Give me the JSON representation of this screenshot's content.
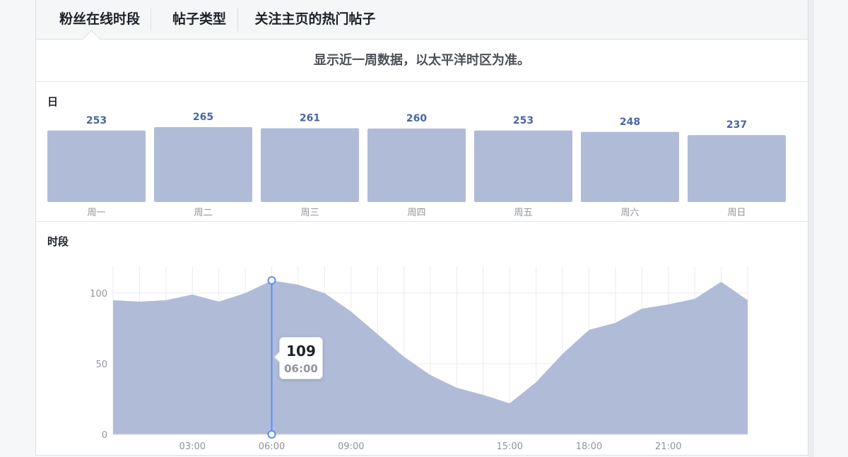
{
  "tabs": [
    {
      "label": "粉丝在线时段",
      "active": true
    },
    {
      "label": "帖子类型",
      "active": false
    },
    {
      "label": "关注主页的热门帖子",
      "active": false
    }
  ],
  "subtitle": "显示近一周数据，以太平洋时区为准。",
  "colors": {
    "bar": "#b0bcd7",
    "value_label": "#4b67a1",
    "area": "#b0bcd7",
    "highlight": "#5b8def"
  },
  "daily": {
    "title": "日",
    "chart_data": {
      "type": "bar",
      "categories": [
        "周一",
        "周二",
        "周三",
        "周四",
        "周五",
        "周六",
        "周日"
      ],
      "values": [
        253,
        265,
        261,
        260,
        253,
        248,
        237
      ]
    }
  },
  "hourly": {
    "title": "时段",
    "chart_data": {
      "type": "area",
      "x": [
        0,
        1,
        2,
        3,
        4,
        5,
        6,
        7,
        8,
        9,
        10,
        11,
        12,
        13,
        14,
        15,
        16,
        17,
        18,
        19,
        20,
        21,
        22,
        23,
        24
      ],
      "values": [
        95,
        94,
        95,
        99,
        94,
        100,
        109,
        106,
        100,
        87,
        71,
        55,
        42,
        33,
        28,
        22,
        37,
        57,
        74,
        79,
        89,
        92,
        96,
        108,
        95
      ],
      "xticks": [
        {
          "x": 3,
          "label": "03:00"
        },
        {
          "x": 6,
          "label": "06:00"
        },
        {
          "x": 9,
          "label": "09:00"
        },
        {
          "x": 15,
          "label": "15:00"
        },
        {
          "x": 18,
          "label": "18:00"
        },
        {
          "x": 21,
          "label": "21:00"
        }
      ],
      "yticks": [
        0,
        50,
        100
      ],
      "ylim": [
        0,
        120
      ],
      "xlim": [
        0,
        24
      ],
      "highlight": {
        "x": 6,
        "value": "109",
        "time": "06:00"
      }
    }
  }
}
